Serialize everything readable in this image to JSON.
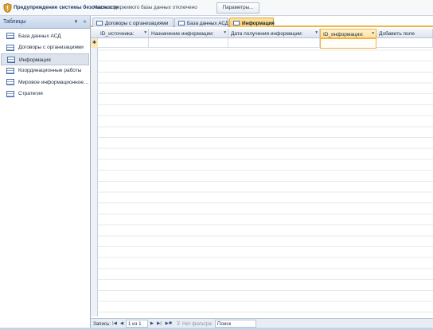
{
  "security_bar": {
    "title": "Предупреждение системы безопасности",
    "message": "Часть содержимого базы данных отключено",
    "params_label": "Параметры..."
  },
  "nav_pane": {
    "header": "Таблицы",
    "collapse_glyph": "«",
    "dropdown_glyph": "▾",
    "items": [
      {
        "label": "База данных АСД",
        "selected": false
      },
      {
        "label": "Договоры с организациями",
        "selected": false
      },
      {
        "label": "Информация",
        "selected": true
      },
      {
        "label": "Координационные работы",
        "selected": false
      },
      {
        "label": "Мировое информационное…",
        "selected": false
      },
      {
        "label": "Стратегия",
        "selected": false
      }
    ]
  },
  "tabs": [
    {
      "label": "Договоры с организациями",
      "active": false
    },
    {
      "label": "База данных АСД",
      "active": false
    },
    {
      "label": "Информация",
      "active": true
    }
  ],
  "datasheet": {
    "columns": [
      {
        "label": "ID_источника:",
        "has_dropdown": true,
        "selected": false
      },
      {
        "label": "Назначение информации:",
        "has_dropdown": true,
        "selected": false
      },
      {
        "label": "Дата получения информации:",
        "has_dropdown": true,
        "selected": false
      },
      {
        "label": "ID_информации:",
        "has_dropdown": true,
        "selected": true
      },
      {
        "label": "Добавить поле",
        "has_dropdown": false,
        "selected": false
      }
    ],
    "new_record_glyph": "✱"
  },
  "record_nav": {
    "label": "Запись:",
    "first_glyph": "|◀",
    "prev_glyph": "◀",
    "position": "1 из 1",
    "next_glyph": "▶",
    "last_glyph": "▶|",
    "new_glyph": "▶✱",
    "filter_label": "Нет фильтра",
    "search_label": "Поиск"
  },
  "colors": {
    "accent": "#f0b34a",
    "nav_header": "#c3d3ea",
    "brand_text": "#1f3a66"
  }
}
